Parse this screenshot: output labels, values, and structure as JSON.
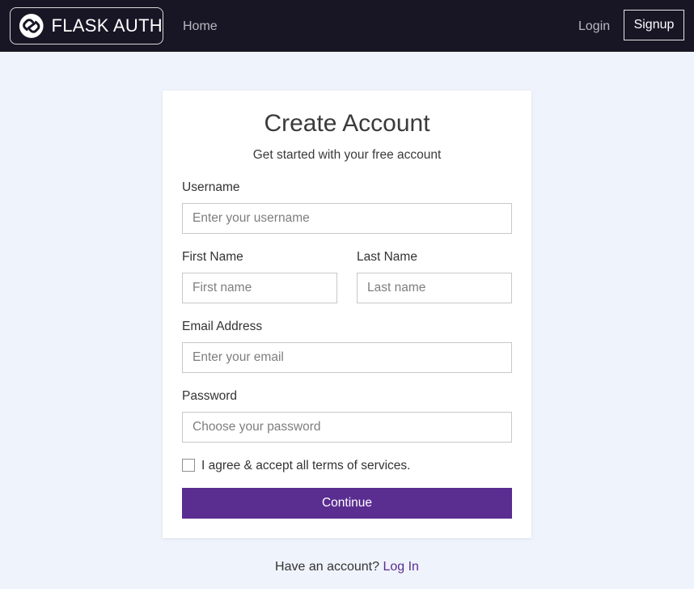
{
  "navbar": {
    "brand_text": "FLASK AUTH",
    "home_label": "Home",
    "login_label": "Login",
    "signup_label": "Signup"
  },
  "form": {
    "title": "Create Account",
    "subtitle": "Get started with your free account",
    "username": {
      "label": "Username",
      "placeholder": "Enter your username",
      "value": ""
    },
    "first_name": {
      "label": "First Name",
      "placeholder": "First name",
      "value": ""
    },
    "last_name": {
      "label": "Last Name",
      "placeholder": "Last name",
      "value": ""
    },
    "email": {
      "label": "Email Address",
      "placeholder": "Enter your email",
      "value": ""
    },
    "password": {
      "label": "Password",
      "placeholder": "Choose your password",
      "value": ""
    },
    "terms_label": "I agree & accept all terms of services.",
    "terms_checked": false,
    "submit_label": "Continue"
  },
  "footer": {
    "prompt": "Have an account?",
    "login_link": "Log In"
  },
  "colors": {
    "navbar_bg": "#181624",
    "page_bg": "#eff3fb",
    "accent": "#5a2d91"
  }
}
